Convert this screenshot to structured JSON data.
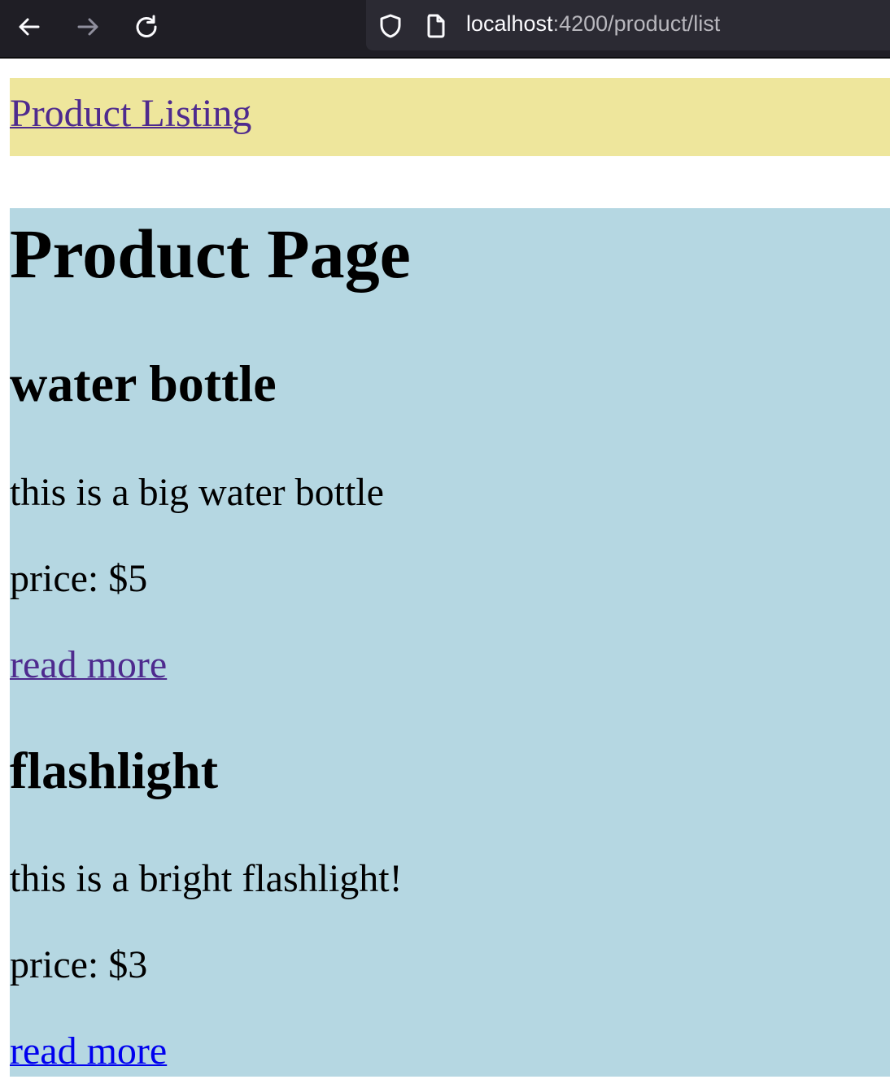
{
  "browser": {
    "url_host": "localhost",
    "url_path": ":4200/product/list",
    "icons": {
      "back": "arrow-left-icon",
      "forward": "arrow-right-icon",
      "reload": "reload-icon",
      "tracking_protection": "shield-icon",
      "page_info": "page-icon"
    }
  },
  "header": {
    "link_label": "Product Listing",
    "background": "#eee69c"
  },
  "main": {
    "background": "#b5d7e2",
    "title": "Product Page",
    "products": [
      {
        "name": "water bottle",
        "description": "this is a big water bottle",
        "price": "price: $5",
        "link_label": "read more"
      },
      {
        "name": "flashlight",
        "description": "this is a bright flashlight!",
        "price": "price: $3",
        "link_label": "read more"
      }
    ]
  },
  "colors": {
    "visited_link": "#4e2a8e",
    "unvisited_link": "#0000ee"
  }
}
